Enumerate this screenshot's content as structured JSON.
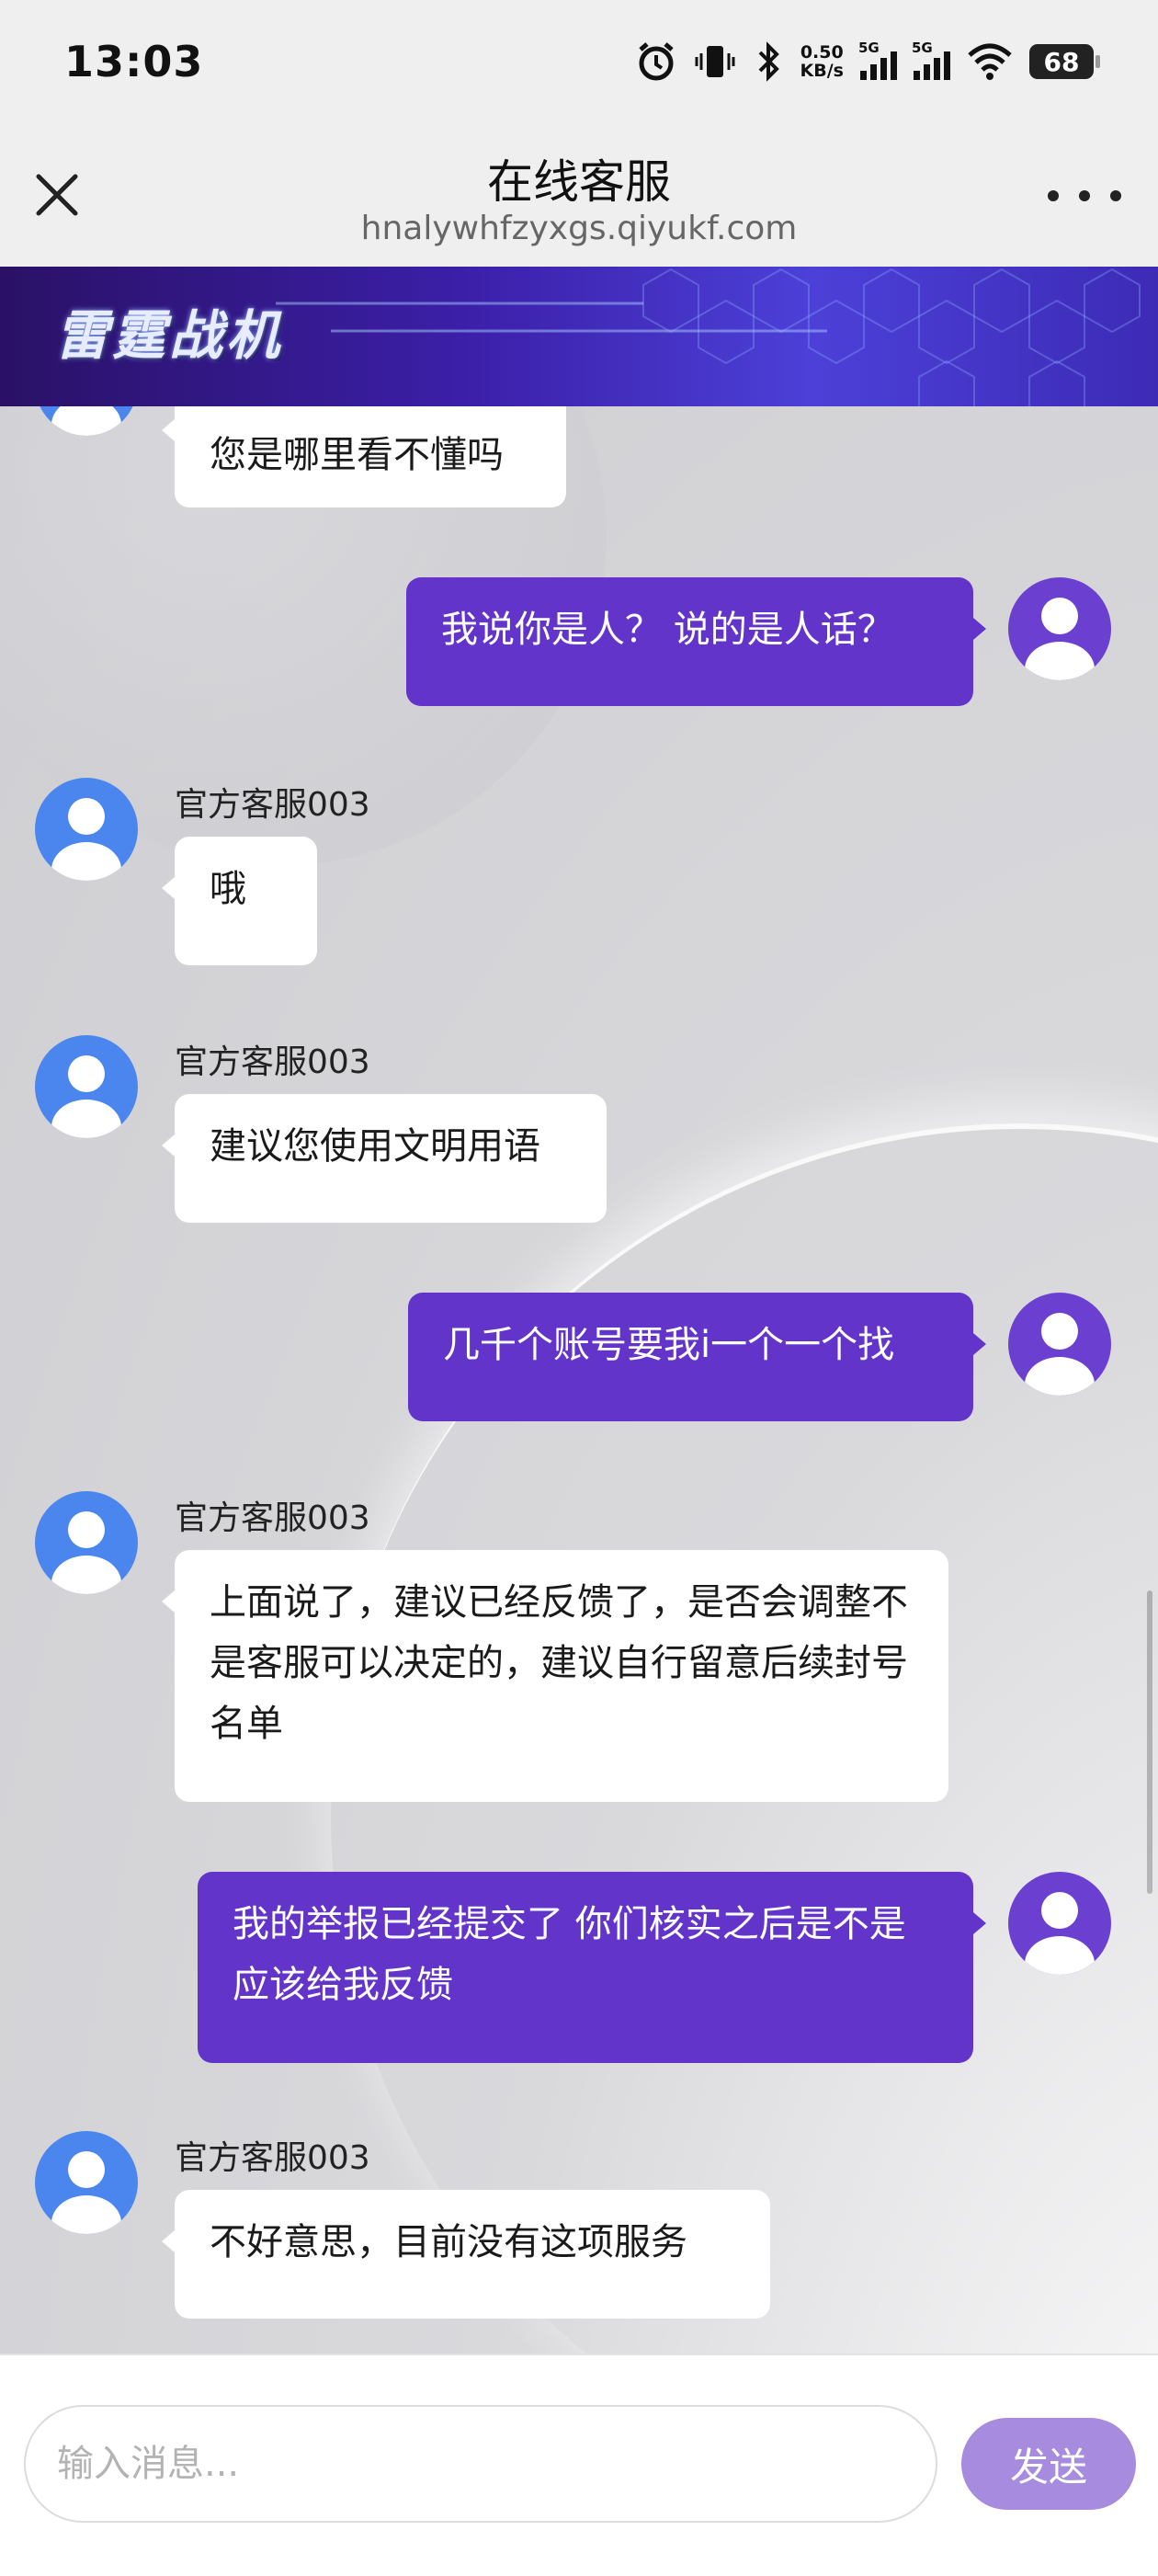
{
  "status_bar": {
    "time": "13:03",
    "net_speed_value": "0.50",
    "net_speed_unit": "KB/s",
    "sig1_label": "5G",
    "sig2_label": "5G",
    "battery": "68"
  },
  "header": {
    "title": "在线客服",
    "url": "hnalywhfzyxgs.qiyukf.com"
  },
  "banner": {
    "logo_text": "雷霆战机"
  },
  "messages": [
    {
      "side": "in",
      "sender": "",
      "text": "您是哪里看不懂吗"
    },
    {
      "side": "out",
      "text": "我说你是人？ 说的是人话？"
    },
    {
      "side": "in",
      "sender": "官方客服003",
      "text": "哦"
    },
    {
      "side": "in",
      "sender": "官方客服003",
      "text": "建议您使用文明用语"
    },
    {
      "side": "out",
      "text": "几千个账号要我i一个一个找"
    },
    {
      "side": "in",
      "sender": "官方客服003",
      "text": "上面说了，建议已经反馈了，是否会调整不是客服可以决定的，建议自行留意后续封号名单"
    },
    {
      "side": "out",
      "text": "我的举报已经提交了   你们核实之后是不是应该给我反馈"
    },
    {
      "side": "in",
      "sender": "官方客服003",
      "text": "不好意思，目前没有这项服务"
    }
  ],
  "composer": {
    "placeholder": "输入消息...",
    "send_label": "发送"
  },
  "colors": {
    "accent": "#6234c9",
    "send_button": "#a68bdf",
    "agent_avatar": "#4b86ee"
  }
}
